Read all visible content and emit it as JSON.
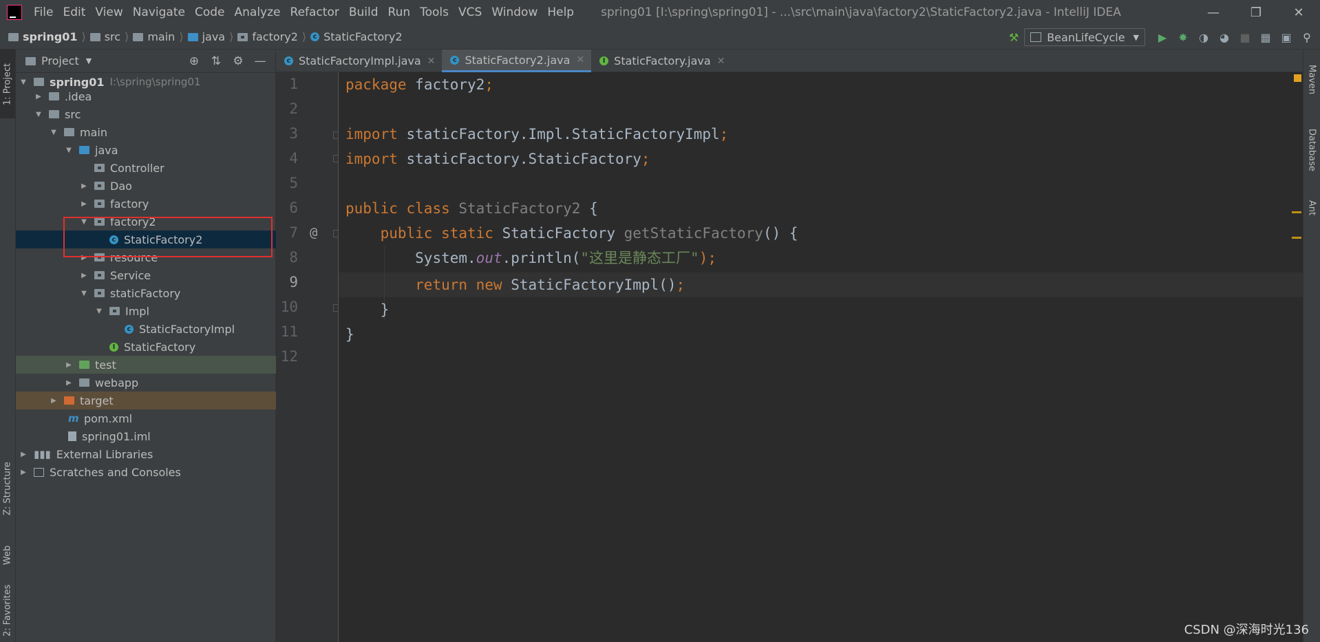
{
  "window": {
    "title": "spring01 [I:\\spring\\spring01] - ...\\src\\main\\java\\factory2\\StaticFactory2.java - IntelliJ IDEA",
    "menu": [
      "File",
      "Edit",
      "View",
      "Navigate",
      "Code",
      "Analyze",
      "Refactor",
      "Build",
      "Run",
      "Tools",
      "VCS",
      "Window",
      "Help"
    ]
  },
  "breadcrumb": [
    "spring01",
    "src",
    "main",
    "java",
    "factory2",
    "StaticFactory2"
  ],
  "run_config": "BeanLifeCycle",
  "left_tabs": {
    "project": "1: Project",
    "structure": "Z: Structure",
    "web": "Web",
    "favorites": "2: Favorites"
  },
  "right_tabs": {
    "maven": "Maven",
    "database": "Database",
    "ant": "Ant"
  },
  "project_panel": {
    "title": "Project",
    "tree": [
      {
        "label": "spring01",
        "hint": "I:\\spring\\spring01"
      },
      {
        "label": ".idea"
      },
      {
        "label": "src"
      },
      {
        "label": "main"
      },
      {
        "label": "java"
      },
      {
        "label": "Controller"
      },
      {
        "label": "Dao"
      },
      {
        "label": "factory"
      },
      {
        "label": "factory2"
      },
      {
        "label": "StaticFactory2"
      },
      {
        "label": "resource"
      },
      {
        "label": "Service"
      },
      {
        "label": "staticFactory"
      },
      {
        "label": "Impl"
      },
      {
        "label": "StaticFactoryImpl"
      },
      {
        "label": "StaticFactory"
      },
      {
        "label": "test"
      },
      {
        "label": "webapp"
      },
      {
        "label": "target"
      },
      {
        "label": "pom.xml"
      },
      {
        "label": "spring01.iml"
      },
      {
        "label": "External Libraries"
      },
      {
        "label": "Scratches and Consoles"
      }
    ]
  },
  "tabs": [
    {
      "label": "StaticFactoryImpl.java"
    },
    {
      "label": "StaticFactory2.java"
    },
    {
      "label": "StaticFactory.java"
    }
  ],
  "editor": {
    "line_numbers": [
      "1",
      "2",
      "3",
      "4",
      "5",
      "6",
      "7",
      "8",
      "9",
      "10",
      "11",
      "12"
    ],
    "code": {
      "l1_kw": "package",
      "l1_name": "factory2",
      "l1_semi": ";",
      "l3_kw": "import",
      "l3_name": "staticFactory.Impl.StaticFactoryImpl",
      "l3_semi": ";",
      "l4_kw": "import",
      "l4_name": "staticFactory.StaticFactory",
      "l4_semi": ";",
      "l6_kw1": "public",
      "l6_kw2": "class",
      "l6_cls": "StaticFactory2",
      "l6_brace": "{",
      "l7_kw1": "public",
      "l7_kw2": "static",
      "l7_type": "StaticFactory",
      "l7_fn": "getStaticFactory",
      "l7_rest": "() {",
      "l8_obj": "System.",
      "l8_fld": "out",
      "l8_call": ".println(",
      "l8_str": "\"这里是静态工厂\"",
      "l8_end": ");",
      "l9_kw1": "return",
      "l9_kw2": "new",
      "l9_call": "StaticFactoryImpl()",
      "l9_semi": ";",
      "l10": "}",
      "l11": "}"
    },
    "gutter_at": "@"
  },
  "watermark": "CSDN @深海时光136"
}
